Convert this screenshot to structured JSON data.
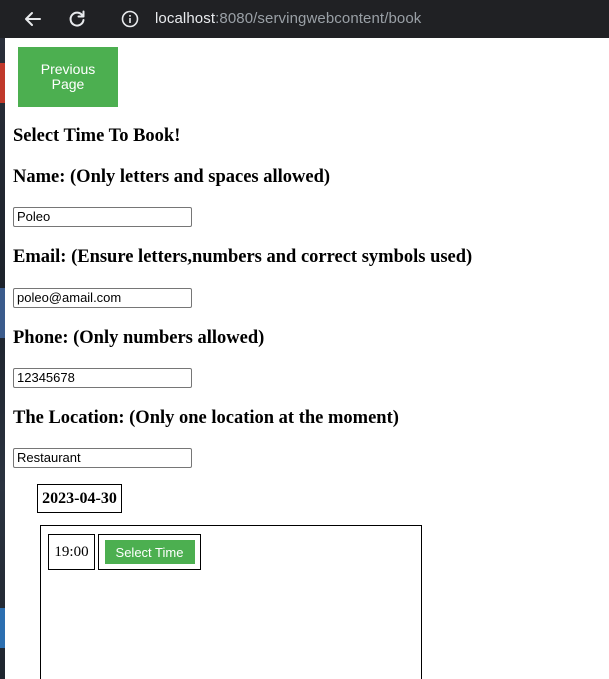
{
  "browser": {
    "url_host": "localhost",
    "url_rest": ":8080/servingwebcontent/book",
    "icons": [
      "back-arrow-icon",
      "reload-icon",
      "site-info-icon"
    ]
  },
  "page": {
    "previous_button": "Previous Page",
    "headings": {
      "title": "Select Time To Book!",
      "name": "Name: (Only letters and spaces allowed)",
      "email": "Email: (Ensure letters,numbers and correct symbols used)",
      "phone": "Phone: (Only numbers allowed)",
      "location": "The Location: (Only one location at the moment)"
    },
    "fields": {
      "name": "Poleo",
      "email": "poleo@amail.com",
      "phone": "12345678",
      "location": "Restaurant"
    },
    "date": "2023-04-30",
    "slots": [
      {
        "time": "19:00",
        "button": "Select Time"
      }
    ],
    "colors": {
      "accent": "#4caf50"
    }
  }
}
